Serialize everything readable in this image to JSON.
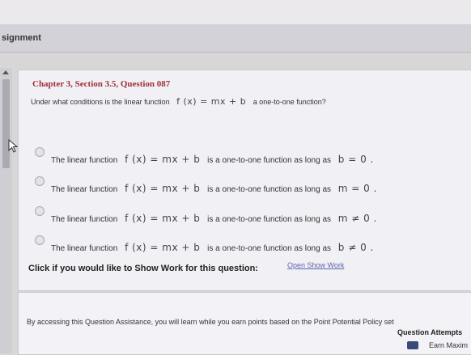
{
  "assignment_title": "signment",
  "question": {
    "title": "Chapter 3, Section 3.5, Question 087",
    "prompt_before": "Under what conditions is the linear function",
    "prompt_math": "f (x) = mx + b",
    "prompt_after": "a one-to-one function?"
  },
  "options": [
    {
      "prefix": "The linear function",
      "math": "f (x) = mx + b",
      "mid": "is a one-to-one function as long as",
      "condition": "b = 0 ."
    },
    {
      "prefix": "The linear function",
      "math": "f (x) = mx + b",
      "mid": "is a one-to-one function as long as",
      "condition": "m = 0 ."
    },
    {
      "prefix": "The linear function",
      "math": "f (x) = mx + b",
      "mid": "is a one-to-one function as long as",
      "condition": "m ≠ 0 ."
    },
    {
      "prefix": "The linear function",
      "math": "f (x) = mx + b",
      "mid": "is a one-to-one function as long as",
      "condition": "b ≠ 0 ."
    }
  ],
  "show_work": {
    "prompt": "Click if you would like to Show Work for this question:",
    "link": "Open Show Work"
  },
  "assistance": {
    "text": "By accessing this Question Assistance, you will learn while you earn points based on the Point Potential Policy set",
    "attempts_title": "Question Attempts",
    "attempts_text": "Earn Maxim"
  }
}
